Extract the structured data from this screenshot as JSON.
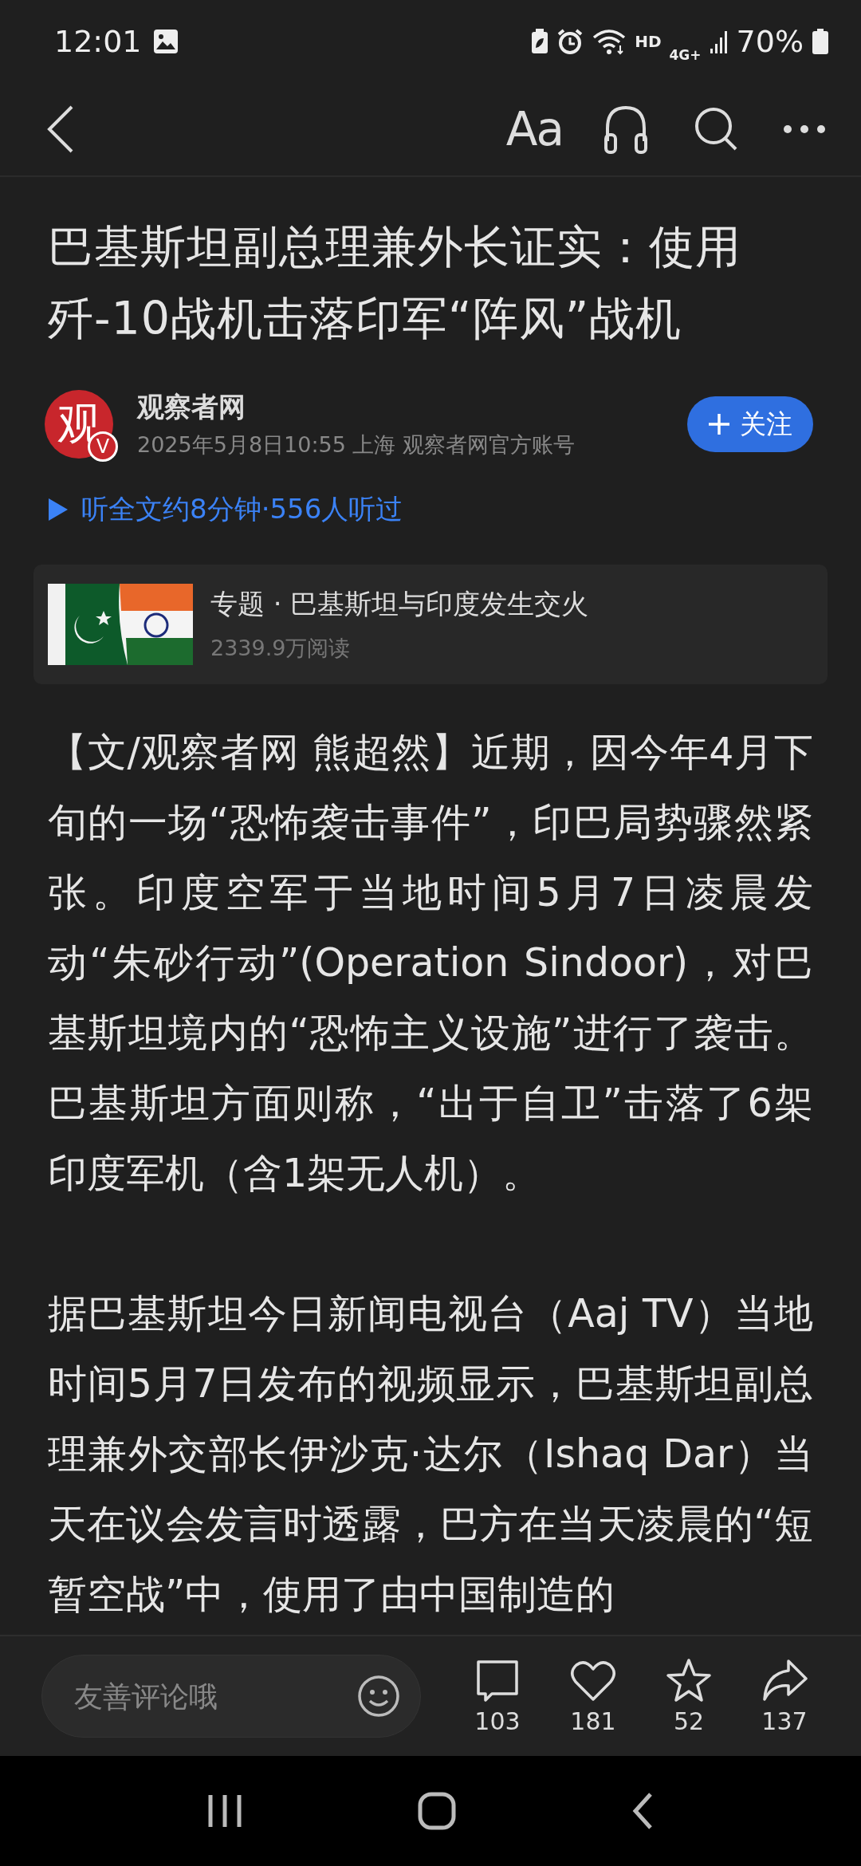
{
  "status_bar": {
    "time": "12:01",
    "hd": "HD",
    "network": "4G+",
    "battery": "70%"
  },
  "toolbar": {
    "font_button": "Aa"
  },
  "article": {
    "title": "巴基斯坦副总理兼外长证实：使用歼-10战机击落印军“阵风”战机",
    "author": {
      "logo": "观",
      "badge": "V",
      "name": "观察者网",
      "meta": "2025年5月8日10:55 上海 观察者网官方账号",
      "follow": "关注"
    },
    "listen": "听全文约8分钟·556人听过",
    "topic": {
      "kind": "picture",
      "title": "专题 · 巴基斯坦与印度发生交火",
      "reads": "2339.9万阅读"
    },
    "paragraphs": [
      "【文/观察者网 熊超然】近期，因今年4月下旬的一场“恐怖袭击事件”，印巴局势骤然紧张。印度空军于当地时间5月7日凌晨发动“朱砂行动”(Operation Sindoor)，对巴基斯坦境内的“恐怖主义设施”进行了袭击。巴基斯坦方面则称，“出于自卫”击落了6架印度军机（含1架无人机）。",
      "据巴基斯坦今日新闻电视台（Aaj TV）当地时间5月7日发布的视频显示，巴基斯坦副总理兼外交部长伊沙克·达尔（Ishaq Dar）当天在议会发言时透露，巴方在当天凌晨的“短暂空战”中，使用了由中国制造的"
    ]
  },
  "comment_bar": {
    "placeholder": "友善评论哦",
    "actions": [
      {
        "kind": "comment",
        "count": "103"
      },
      {
        "kind": "like",
        "count": "181"
      },
      {
        "kind": "favorite",
        "count": "52"
      },
      {
        "kind": "share",
        "count": "137"
      }
    ]
  }
}
